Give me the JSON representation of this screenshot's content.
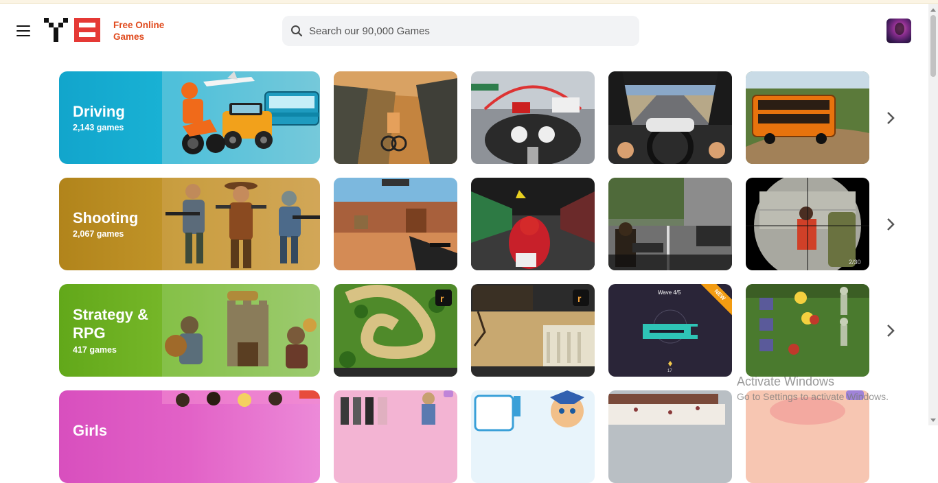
{
  "header": {
    "brand_line1": "Free Online",
    "brand_line2": "Games",
    "search_placeholder": "Search our 90,000 Games"
  },
  "categories": [
    {
      "title": "Driving",
      "count": "2,143 games",
      "color": "#1ba6c9"
    },
    {
      "title": "Shooting",
      "count": "2,067 games",
      "color": "#b5881e"
    },
    {
      "title": "Strategy & RPG",
      "count": "417 games",
      "color": "#6aac1c"
    },
    {
      "title": "Girls",
      "count": "",
      "color": "#d94fbd"
    }
  ],
  "badges": {
    "new": "NEW",
    "wave": "Wave 4/5",
    "ammo": "2/30"
  },
  "watermark": {
    "title": "Activate Windows",
    "subtitle": "Go to Settings to activate Windows."
  }
}
